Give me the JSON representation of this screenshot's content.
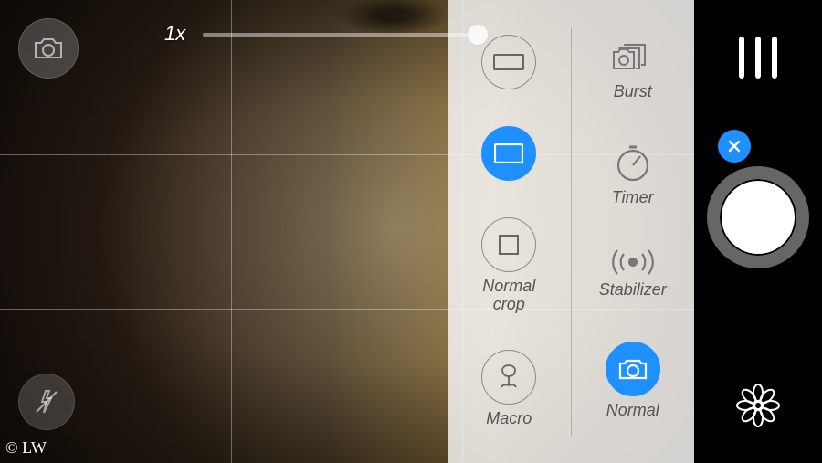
{
  "viewfinder": {
    "zoom_label": "1x"
  },
  "options": {
    "left": {
      "aspect_wide_label": "",
      "aspect_normal_label": "",
      "crop_label": "Normal\ncrop",
      "macro_label": "Macro"
    },
    "right": {
      "burst_label": "Burst",
      "timer_label": "Timer",
      "stabilizer_label": "Stabilizer",
      "normal_label": "Normal"
    }
  },
  "watermark": "© LW",
  "colors": {
    "accent": "#1e90ff"
  }
}
